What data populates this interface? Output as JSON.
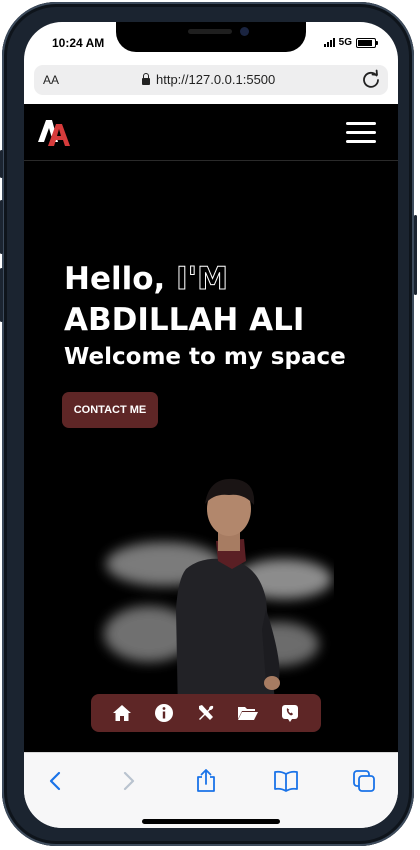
{
  "status_bar": {
    "time": "10:24 AM",
    "network": "5G"
  },
  "browser": {
    "text_size_label": "AA",
    "url": "http://127.0.0.1:5500"
  },
  "site": {
    "logo_text": "AA",
    "hero": {
      "greeting": "Hello,",
      "greeting_outline": "I'M",
      "name": "ABDILLAH ALI",
      "tagline": "Welcome to my space",
      "cta_label": "CONTACT ME"
    },
    "bottom_nav": [
      "home-icon",
      "info-icon",
      "tools-icon",
      "folder-icon",
      "phone-icon"
    ]
  },
  "colors": {
    "accent": "#5e2626",
    "background": "#000000",
    "browser_blue": "#1a73e8"
  }
}
